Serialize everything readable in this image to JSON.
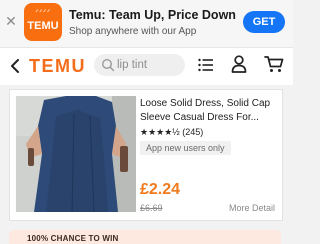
{
  "banner": {
    "close_icon": "close-icon",
    "app_icon_text": "TEMU",
    "app_icon_decor": "ᐟᐟᐟᐟ",
    "title": "Temu: Team Up, Price Down",
    "subtitle": "Shop anywhere with our App",
    "get_label": "GET"
  },
  "nav": {
    "logo": "TEMU",
    "search_placeholder": "lip tint"
  },
  "product": {
    "name": "Loose Solid Dress, Solid Cap Sleeve Casual Dress For...",
    "stars": "★★★★½",
    "rating_count": "(245)",
    "tag": "App new users only",
    "price": "£2.24",
    "original_price": "£6.69",
    "more_detail": "More Detail"
  },
  "promo_strip": {
    "text": "100% CHANCE TO WIN"
  },
  "colors": {
    "brand_orange": "#f36d1a",
    "price_orange": "#f07a1c",
    "get_blue": "#1476f6"
  }
}
